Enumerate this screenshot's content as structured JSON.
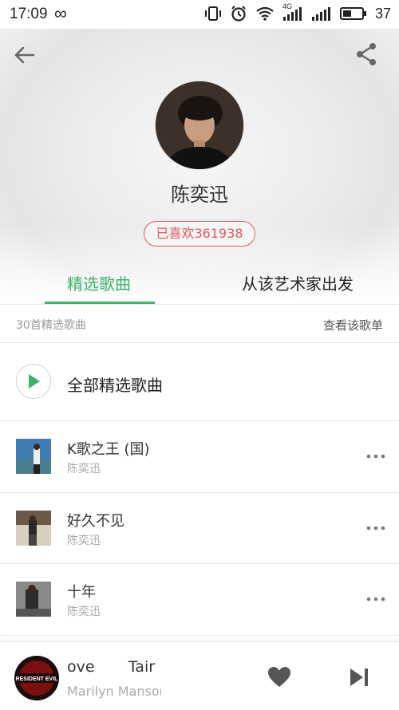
{
  "status_bar": {
    "time": "17:09",
    "infinity_glyph": "∞",
    "network": "4G",
    "battery": "37"
  },
  "header": {
    "back_icon": "arrow-left-icon",
    "share_icon": "share-icon"
  },
  "artist": {
    "name": "陈奕迅",
    "likes_label": "已喜欢361938"
  },
  "tabs": [
    {
      "label": "精选歌曲",
      "active": true
    },
    {
      "label": "从该艺术家出发",
      "active": false
    }
  ],
  "list_header": {
    "count_label": "30首精选歌曲",
    "view_playlist": "查看该歌单"
  },
  "play_all": {
    "label": "全部精选歌曲",
    "icon": "play-icon"
  },
  "songs": [
    {
      "title": "K歌之王 (国)",
      "artist": "陈奕迅"
    },
    {
      "title": "好久不见",
      "artist": "陈奕迅"
    },
    {
      "title": "十年",
      "artist": "陈奕迅"
    }
  ],
  "now_playing": {
    "title": "ove       Tair",
    "artist": "Marilyn Manson",
    "disc_text": "RESIDENT EVIL",
    "heart_icon": "heart-icon",
    "next_icon": "skip-next-icon"
  },
  "colors": {
    "accent": "#3bb36a",
    "like_red": "#e05a5a"
  }
}
